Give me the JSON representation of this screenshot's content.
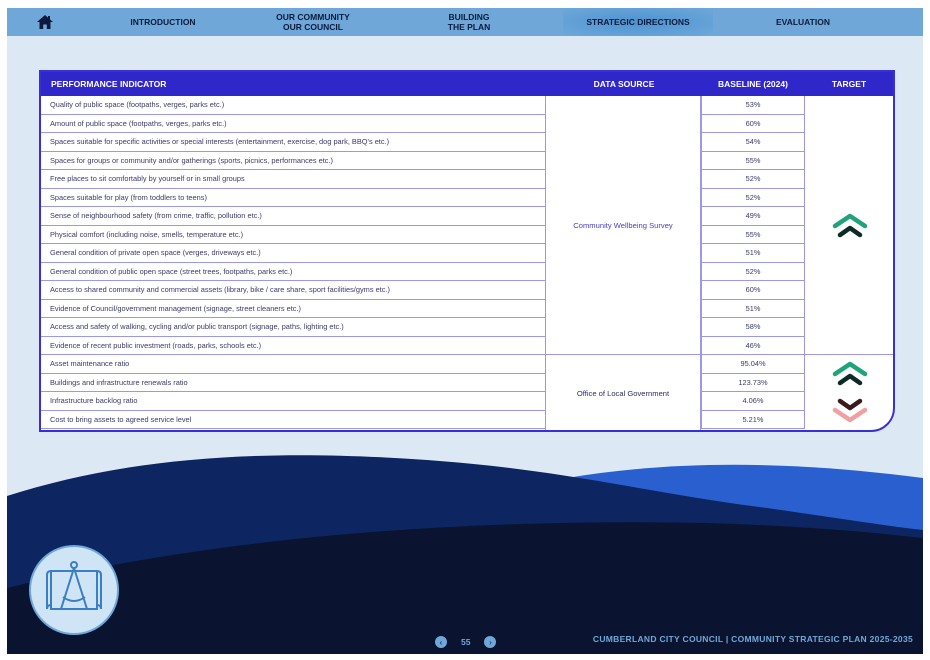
{
  "nav": {
    "home_icon": "home-icon",
    "items": [
      {
        "line1": "INTRODUCTION",
        "line2": ""
      },
      {
        "line1": "OUR COMMUNITY",
        "line2": "OUR COUNCIL"
      },
      {
        "line1": "BUILDING",
        "line2": "THE PLAN"
      },
      {
        "line1": "STRATEGIC DIRECTIONS",
        "line2": ""
      },
      {
        "line1": "EVALUATION",
        "line2": ""
      }
    ],
    "active": "STRATEGIC DIRECTIONS"
  },
  "table": {
    "headers": {
      "indicator": "PERFORMANCE INDICATOR",
      "source": "DATA SOURCE",
      "baseline": "BASELINE (2024)",
      "target": "TARGET"
    },
    "rows": [
      {
        "indicator": "Quality of public space (footpaths, verges, parks etc.)",
        "baseline": "53%"
      },
      {
        "indicator": "Amount of public space (footpaths, verges, parks etc.)",
        "baseline": "60%"
      },
      {
        "indicator": "Spaces suitable for specific activities or special interests (entertainment, exercise, dog park, BBQ's etc.)",
        "baseline": "54%"
      },
      {
        "indicator": "Spaces for groups or community and/or gatherings (sports, picnics, performances etc.)",
        "baseline": "55%"
      },
      {
        "indicator": "Free places to sit comfortably by yourself or in small groups",
        "baseline": "52%"
      },
      {
        "indicator": "Spaces suitable for play (from toddlers to teens)",
        "baseline": "52%"
      },
      {
        "indicator": "Sense of neighbourhood safety (from crime, traffic, pollution etc.)",
        "baseline": "49%"
      },
      {
        "indicator": "Physical comfort (including noise, smells, temperature etc.)",
        "baseline": "55%"
      },
      {
        "indicator": "General condition of private open space (verges, driveways etc.)",
        "baseline": "51%"
      },
      {
        "indicator": "General condition of public open space (street trees, footpaths, parks etc.)",
        "baseline": "52%"
      },
      {
        "indicator": "Access to shared community and commercial assets (library, bike / care share, sport facilities/gyms etc.)",
        "baseline": "60%"
      },
      {
        "indicator": "Evidence of Council/government management (signage, street cleaners etc.)",
        "baseline": "51%"
      },
      {
        "indicator": "Access and safety of walking, cycling and/or public transport (signage, paths, lighting etc.)",
        "baseline": "58%"
      },
      {
        "indicator": "Evidence of recent public investment (roads, parks, schools etc.)",
        "baseline": "46%"
      },
      {
        "indicator": "Asset maintenance ratio",
        "baseline": "95.04%"
      },
      {
        "indicator": "Buildings and infrastructure renewals ratio",
        "baseline": "123.73%"
      },
      {
        "indicator": "Infrastructure backlog ratio",
        "baseline": "4.06%"
      },
      {
        "indicator": "Cost to bring assets to agreed service level",
        "baseline": "5.21%"
      }
    ],
    "sources": [
      {
        "label": "Community Wellbeing Survey"
      },
      {
        "label": "Office of Local Government"
      }
    ],
    "targets": {
      "group1": "increase-arrow-icon",
      "group2_up": "increase-arrow-icon",
      "group2_down": "decrease-arrow-icon",
      "up_color_top": "#1fa37a",
      "up_color_bottom": "#0d2a2a",
      "down_color_top": "#3a1a1a",
      "down_color_bottom": "#f0a0a0"
    }
  },
  "footer": {
    "page_number": "55",
    "prev_icon": "chevron-left-icon",
    "next_icon": "chevron-right-icon",
    "text": "CUMBERLAND CITY COUNCIL  |  COMMUNITY STRATEGIC PLAN 2025-2035",
    "logo_icon": "compass-blueprint-icon"
  },
  "colors": {
    "page_bg": "#dce9f5",
    "nav_bg": "#6fa8d8",
    "table_header_bg": "#2f27c9",
    "table_border": "#3a2fd6",
    "footer_wave_dark": "#0a1430",
    "footer_wave_blue": "#2a5fd0"
  }
}
